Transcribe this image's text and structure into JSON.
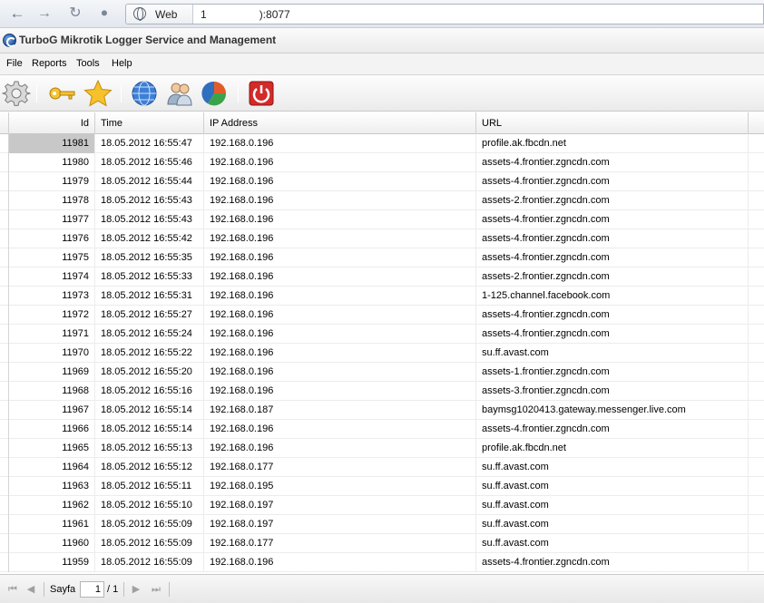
{
  "browser": {
    "back_icon": "arrow-left-icon",
    "forward_icon": "arrow-right-icon",
    "reload_icon": "reload-icon",
    "key_icon": "key-icon",
    "site_chip_label": "Web",
    "url_prefix": "1",
    "url_suffix": "):8077"
  },
  "app": {
    "title": "TurboG Mikrotik Logger Service and Management"
  },
  "menu": {
    "items": [
      "File",
      "Reports",
      "Tools",
      "Help"
    ]
  },
  "toolbar": {
    "icons": [
      "gear-icon",
      "key-icon",
      "star-icon",
      "globe-icon",
      "users-icon",
      "pie-chart-icon",
      "power-icon"
    ],
    "colors": {
      "accent": "#1f4f9c",
      "power": "#d32a2a",
      "star": "#f3b51c"
    }
  },
  "grid": {
    "columns": [
      "Id",
      "Time",
      "IP Address",
      "URL"
    ],
    "rows": [
      {
        "id": "11981",
        "time": "18.05.2012 16:55:47",
        "ip": "192.168.0.196",
        "url": "profile.ak.fbcdn.net"
      },
      {
        "id": "11980",
        "time": "18.05.2012 16:55:46",
        "ip": "192.168.0.196",
        "url": "assets-4.frontier.zgncdn.com"
      },
      {
        "id": "11979",
        "time": "18.05.2012 16:55:44",
        "ip": "192.168.0.196",
        "url": "assets-4.frontier.zgncdn.com"
      },
      {
        "id": "11978",
        "time": "18.05.2012 16:55:43",
        "ip": "192.168.0.196",
        "url": "assets-2.frontier.zgncdn.com"
      },
      {
        "id": "11977",
        "time": "18.05.2012 16:55:43",
        "ip": "192.168.0.196",
        "url": "assets-4.frontier.zgncdn.com"
      },
      {
        "id": "11976",
        "time": "18.05.2012 16:55:42",
        "ip": "192.168.0.196",
        "url": "assets-4.frontier.zgncdn.com"
      },
      {
        "id": "11975",
        "time": "18.05.2012 16:55:35",
        "ip": "192.168.0.196",
        "url": "assets-4.frontier.zgncdn.com"
      },
      {
        "id": "11974",
        "time": "18.05.2012 16:55:33",
        "ip": "192.168.0.196",
        "url": "assets-2.frontier.zgncdn.com"
      },
      {
        "id": "11973",
        "time": "18.05.2012 16:55:31",
        "ip": "192.168.0.196",
        "url": "1-125.channel.facebook.com"
      },
      {
        "id": "11972",
        "time": "18.05.2012 16:55:27",
        "ip": "192.168.0.196",
        "url": "assets-4.frontier.zgncdn.com"
      },
      {
        "id": "11971",
        "time": "18.05.2012 16:55:24",
        "ip": "192.168.0.196",
        "url": "assets-4.frontier.zgncdn.com"
      },
      {
        "id": "11970",
        "time": "18.05.2012 16:55:22",
        "ip": "192.168.0.196",
        "url": "su.ff.avast.com"
      },
      {
        "id": "11969",
        "time": "18.05.2012 16:55:20",
        "ip": "192.168.0.196",
        "url": "assets-1.frontier.zgncdn.com"
      },
      {
        "id": "11968",
        "time": "18.05.2012 16:55:16",
        "ip": "192.168.0.196",
        "url": "assets-3.frontier.zgncdn.com"
      },
      {
        "id": "11967",
        "time": "18.05.2012 16:55:14",
        "ip": "192.168.0.187",
        "url": "baymsg1020413.gateway.messenger.live.com"
      },
      {
        "id": "11966",
        "time": "18.05.2012 16:55:14",
        "ip": "192.168.0.196",
        "url": "assets-4.frontier.zgncdn.com"
      },
      {
        "id": "11965",
        "time": "18.05.2012 16:55:13",
        "ip": "192.168.0.196",
        "url": "profile.ak.fbcdn.net"
      },
      {
        "id": "11964",
        "time": "18.05.2012 16:55:12",
        "ip": "192.168.0.177",
        "url": "su.ff.avast.com"
      },
      {
        "id": "11963",
        "time": "18.05.2012 16:55:11",
        "ip": "192.168.0.195",
        "url": "su.ff.avast.com"
      },
      {
        "id": "11962",
        "time": "18.05.2012 16:55:10",
        "ip": "192.168.0.197",
        "url": "su.ff.avast.com"
      },
      {
        "id": "11961",
        "time": "18.05.2012 16:55:09",
        "ip": "192.168.0.197",
        "url": "su.ff.avast.com"
      },
      {
        "id": "11960",
        "time": "18.05.2012 16:55:09",
        "ip": "192.168.0.177",
        "url": "su.ff.avast.com"
      },
      {
        "id": "11959",
        "time": "18.05.2012 16:55:09",
        "ip": "192.168.0.196",
        "url": "assets-4.frontier.zgncdn.com"
      }
    ]
  },
  "pager": {
    "page_label": "Sayfa",
    "current_page": "1",
    "total_pages": "/ 1"
  }
}
